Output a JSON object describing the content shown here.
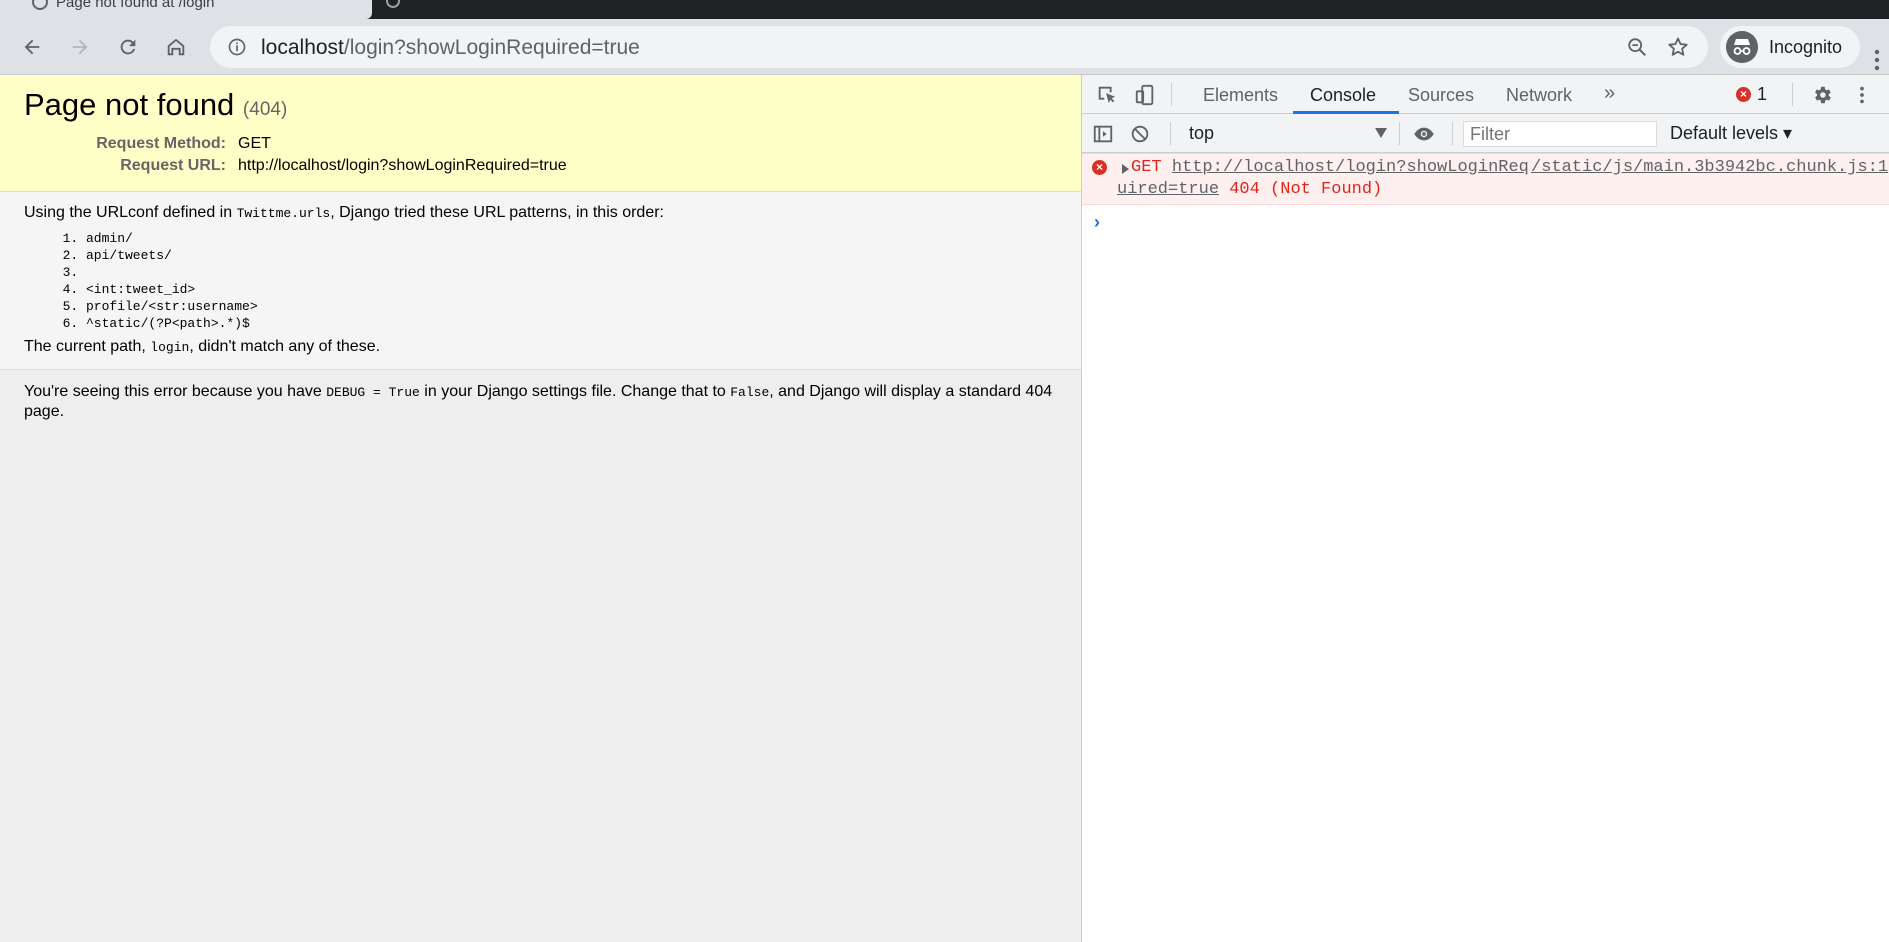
{
  "browser": {
    "tab_title": "Page not found at /login",
    "url_host": "localhost",
    "url_path": "/login?showLoginRequired=true",
    "profile_label": "Incognito",
    "icons": [
      "back-icon",
      "forward-icon",
      "reload-icon",
      "home-icon",
      "info-icon",
      "zoom-out-icon",
      "star-icon",
      "incognito-icon",
      "kebab-menu-icon"
    ]
  },
  "page": {
    "title": "Page not found",
    "code": "(404)",
    "request_method_label": "Request Method:",
    "request_method": "GET",
    "request_url_label": "Request URL:",
    "request_url": "http://localhost/login?showLoginRequired=true",
    "urlconf_prefix": "Using the URLconf defined in ",
    "urlconf_module": "Twittme.urls",
    "urlconf_suffix": ", Django tried these URL patterns, in this order:",
    "patterns": [
      "admin/",
      "api/tweets/",
      "",
      "<int:tweet_id>",
      "profile/<str:username>",
      "^static/(?P<path>.*)$"
    ],
    "current_prefix": "The current path, ",
    "current_path": "login",
    "current_suffix": ", didn't match any of these.",
    "explain_prefix": "You're seeing this error because you have ",
    "explain_code1": "DEBUG = True",
    "explain_mid": " in your Django settings file. Change that to ",
    "explain_code2": "False",
    "explain_suffix": ", and Django will display a standard 404 page."
  },
  "devtools": {
    "tabs": [
      "Elements",
      "Console",
      "Sources",
      "Network"
    ],
    "more_tabs": "»",
    "error_count": "1",
    "context": "top",
    "filter_placeholder": "Filter",
    "levels": "Default levels ▾",
    "error": {
      "method": "GET",
      "url_part1": "http://localhost/login?showLoginReq",
      "url_part2": "uired=true",
      "status": "404 (Not Found)",
      "source": "/static/js/main.3b3942bc.chunk.js:1"
    },
    "prompt": "›",
    "colors": {
      "accent": "#1a73e8",
      "error": "#d93025",
      "summary_bg": "#ffffc8"
    }
  }
}
